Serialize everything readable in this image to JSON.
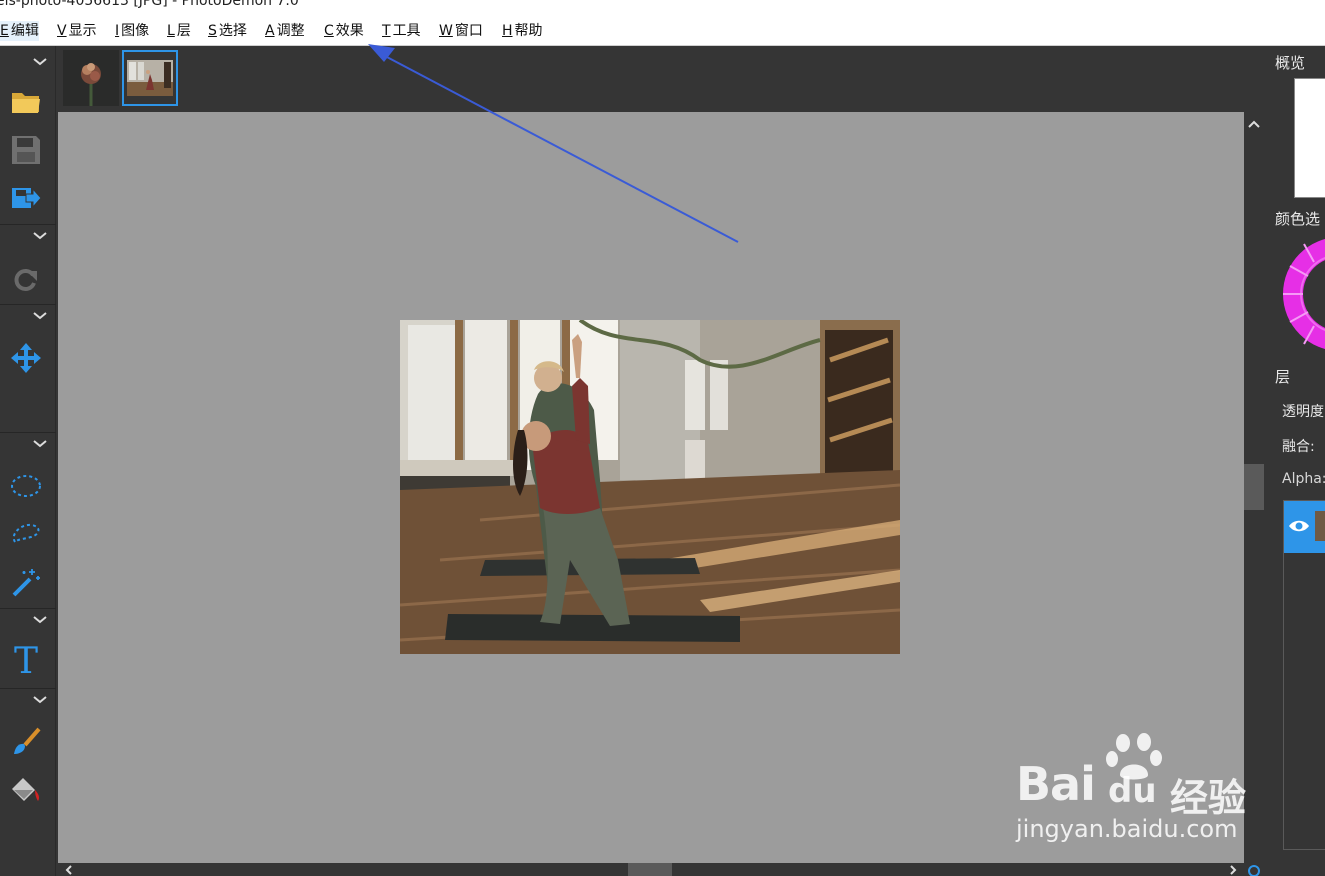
{
  "window": {
    "title_fragment": "els-photo-4056613 [JPG]  -  PhotoDemon 7.0"
  },
  "menu": [
    {
      "key": "E",
      "label": "编辑"
    },
    {
      "key": "V",
      "label": "显示"
    },
    {
      "key": "I",
      "label": "图像"
    },
    {
      "key": "L",
      "label": "层"
    },
    {
      "key": "S",
      "label": "选择"
    },
    {
      "key": "A",
      "label": "调整"
    },
    {
      "key": "C",
      "label": "效果"
    },
    {
      "key": "T",
      "label": "工具"
    },
    {
      "key": "W",
      "label": "窗口"
    },
    {
      "key": "H",
      "label": "帮助"
    }
  ],
  "toolbox": {
    "icons": [
      "open-folder-icon",
      "save-icon",
      "export-icon",
      "redo-icon",
      "move-icon",
      "ellipse-select-icon",
      "lasso-select-icon",
      "magic-wand-icon",
      "text-tool-icon",
      "paintbrush-icon",
      "paint-bucket-icon"
    ],
    "text_tool_glyph": "T"
  },
  "panel": {
    "overview_label": "概览",
    "color_label": "颜色选",
    "layers_label": "层",
    "opacity_label": "透明度",
    "blend_label": "融合:",
    "alpha_label": "Alpha:"
  },
  "watermark": {
    "brand": "Bai",
    "brand2": "du",
    "cn": "经验",
    "url": "jingyan.baidu.com"
  },
  "colors": {
    "accent": "#2e95e8",
    "canvas_bg": "#9c9c9c",
    "chrome_bg": "#353535",
    "annotation_arrow": "#3a5bd6",
    "color_wheel": "#e62fe6"
  }
}
